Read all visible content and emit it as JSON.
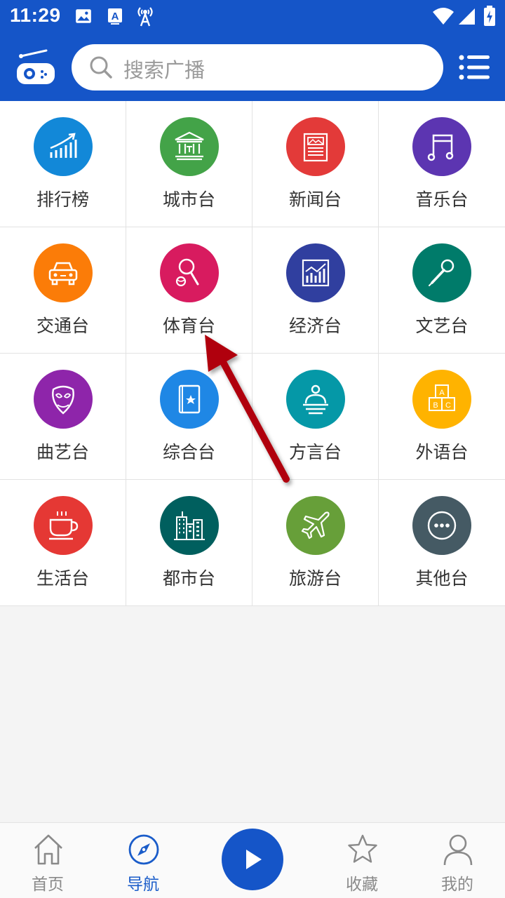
{
  "status_bar": {
    "time": "11:29",
    "icons": [
      "image-icon",
      "keyboard-a-icon",
      "broadcast-tower-icon",
      "wifi-icon",
      "signal-icon",
      "battery-charging-icon"
    ]
  },
  "header": {
    "logo_icon": "radio-icon",
    "search": {
      "placeholder": "搜索广播",
      "icon": "search-icon"
    },
    "menu_icon": "list-menu-icon"
  },
  "categories": [
    {
      "label": "排行榜",
      "icon": "chart-up-icon",
      "color": "#1288d8"
    },
    {
      "label": "城市台",
      "icon": "building-columns-icon",
      "color": "#43a348"
    },
    {
      "label": "新闻台",
      "icon": "newspaper-icon",
      "color": "#e33a39"
    },
    {
      "label": "音乐台",
      "icon": "music-note-icon",
      "color": "#5c35b1"
    },
    {
      "label": "交通台",
      "icon": "car-icon",
      "color": "#fb7c08"
    },
    {
      "label": "体育台",
      "icon": "racket-ball-icon",
      "color": "#d81b5f"
    },
    {
      "label": "经济台",
      "icon": "economy-chart-icon",
      "color": "#303f9f"
    },
    {
      "label": "文艺台",
      "icon": "microphone-icon",
      "color": "#007b6a"
    },
    {
      "label": "曲艺台",
      "icon": "opera-mask-icon",
      "color": "#8e25aa"
    },
    {
      "label": "综合台",
      "icon": "book-star-icon",
      "color": "#1f87e5"
    },
    {
      "label": "方言台",
      "icon": "speaker-podium-icon",
      "color": "#0598a7"
    },
    {
      "label": "外语台",
      "icon": "abc-blocks-icon",
      "color": "#ffb300"
    },
    {
      "label": "生活台",
      "icon": "coffee-cup-icon",
      "color": "#e53834"
    },
    {
      "label": "都市台",
      "icon": "city-buildings-icon",
      "color": "#005f5e"
    },
    {
      "label": "旅游台",
      "icon": "airplane-icon",
      "color": "#679f39"
    },
    {
      "label": "其他台",
      "icon": "more-dots-icon",
      "color": "#455a64"
    }
  ],
  "bottom_nav": {
    "items": [
      {
        "label": "首页",
        "icon": "home-icon"
      },
      {
        "label": "导航",
        "icon": "compass-icon",
        "active": true
      },
      {
        "label": "",
        "icon": "play-icon"
      },
      {
        "label": "收藏",
        "icon": "star-icon"
      },
      {
        "label": "我的",
        "icon": "user-icon"
      }
    ],
    "active_color": "#1a5cc9",
    "inactive_color": "#8a8a8a"
  },
  "colors": {
    "primary": "#1555c8",
    "annotation_arrow": "#b0000b"
  }
}
